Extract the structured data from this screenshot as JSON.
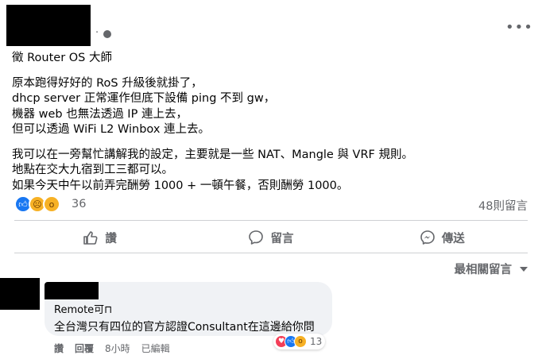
{
  "post": {
    "more_glyph": "•••",
    "privacy_separator": "·",
    "lines_para1": [
      "徵 Router OS 大師",
      "原本跑得好好的 RoS 升級後就掛了，",
      "dhcp server 正常運作但底下設備 ping 不到 gw，",
      "機器 web 也無法透過 IP 連上去，",
      "但可以透過 WiFi L2 Winbox 連上去。"
    ],
    "lines_para2": [
      "我可以在一旁幫忙講解我的設定，主要就是一些 NAT、Mangle 與 VRF 規則。",
      "地點在交大九宿到工三都可以。",
      "如果今天中午以前弄完酬勞 1000 + 一頓午餐，否則酬勞 1000。"
    ]
  },
  "stats": {
    "reaction_count": "36",
    "comment_count": "48則留言",
    "reactions": [
      "like-icon",
      "sad-icon",
      "wow-icon"
    ]
  },
  "actions": {
    "like": "讚",
    "comment": "留言",
    "share": "傳送"
  },
  "sort": {
    "label": "最相關留言"
  },
  "comment": {
    "author": "Remote可⊓",
    "text": "全台灣只有四位的官方認證Consultant在這邊給你問",
    "reaction_count": "13",
    "like_label": "讚",
    "reply_label": "回覆",
    "time": "8小時",
    "edited": "已編輯"
  },
  "colors": {
    "accent": "#1877f2",
    "muted": "#65676b",
    "bubble": "#f0f2f5",
    "divider": "#ced0d4"
  }
}
